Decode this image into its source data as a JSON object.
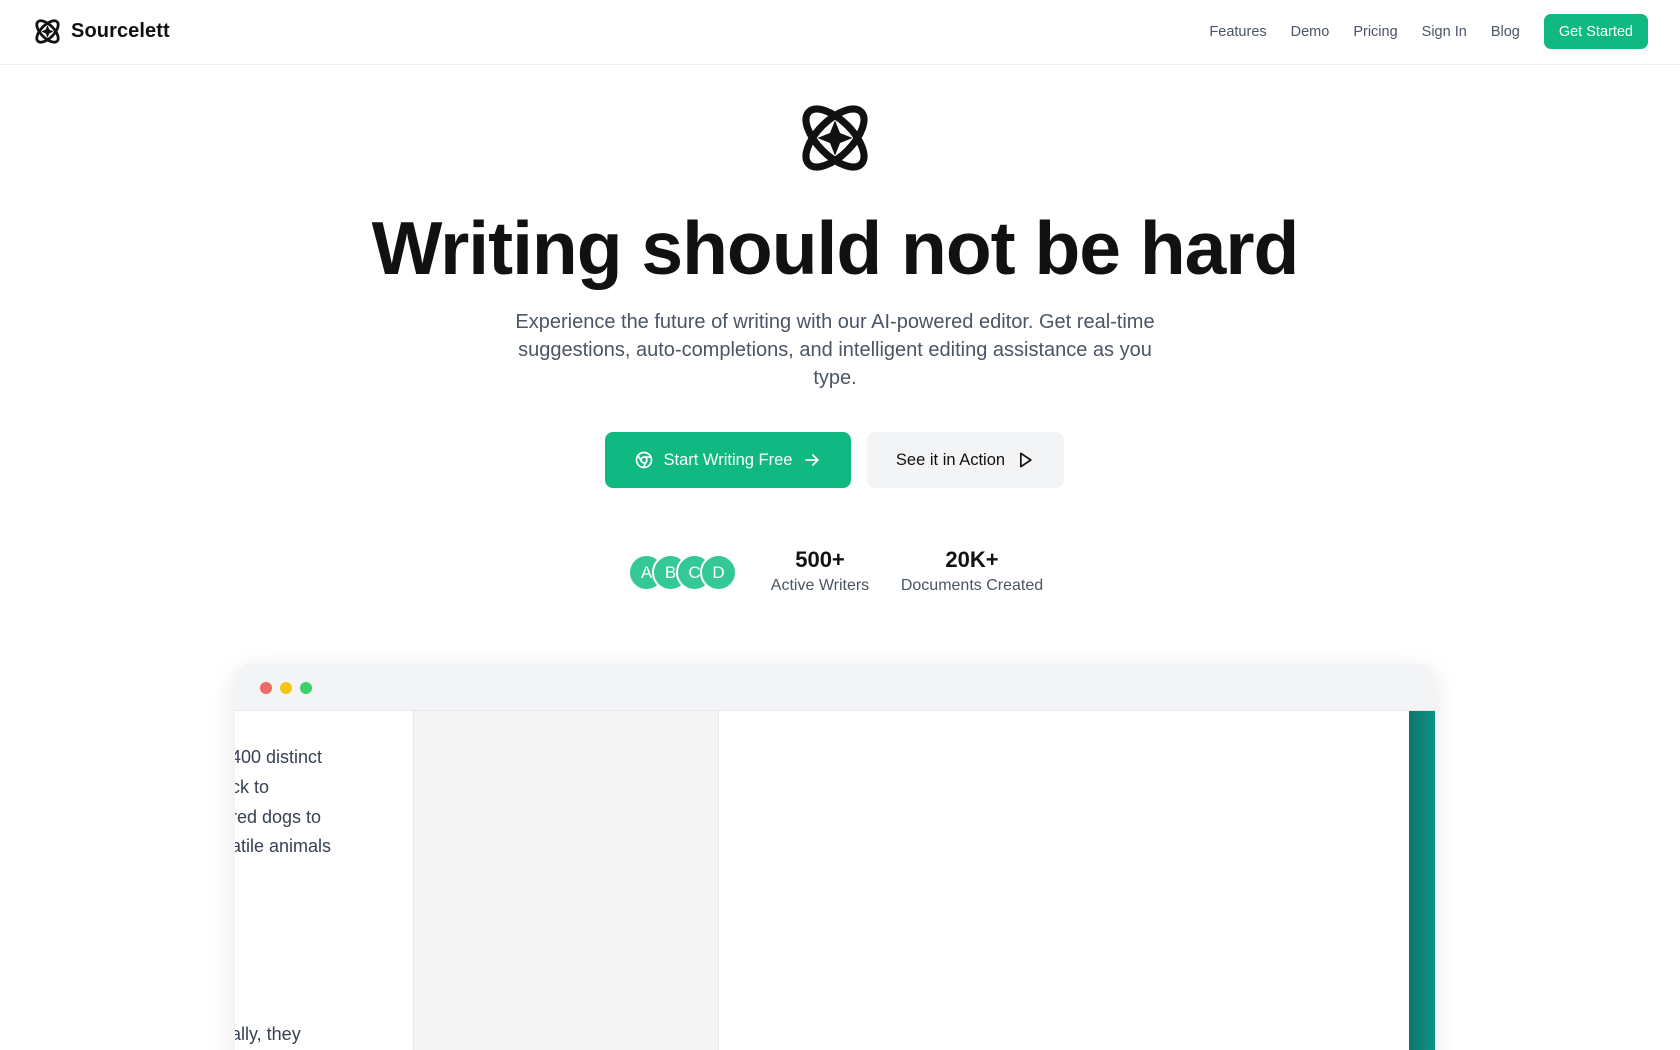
{
  "brand": {
    "name": "Sourcelett",
    "logo_icon": "orbit-sparkle-logo-icon"
  },
  "nav": {
    "links": [
      "Features",
      "Demo",
      "Pricing",
      "Sign In",
      "Blog"
    ],
    "cta": "Get Started"
  },
  "hero": {
    "title": "Writing should not be hard",
    "subtitle": "Experience the future of writing with our AI-powered editor. Get real-time suggestions, auto-completions, and intelligent editing assistance as you type.",
    "primary_button": {
      "label": "Start Writing Free",
      "icon": "chrome-icon",
      "trailing_icon": "arrow-right-icon"
    },
    "secondary_button": {
      "label": "See it in Action",
      "icon": "play-icon"
    }
  },
  "stats": {
    "avatars": [
      "A",
      "B",
      "C",
      "D"
    ],
    "items": [
      {
        "value": "500+",
        "label": "Active Writers"
      },
      {
        "value": "20K+",
        "label": "Documents Created"
      }
    ]
  },
  "preview": {
    "window_dots": [
      "#ef6b6b",
      "#f5c518",
      "#3ccf6e"
    ],
    "text_lines": [
      "400 distinct",
      "ck to",
      "red dogs to",
      "atile animals",
      "ally, they"
    ]
  },
  "colors": {
    "accent": "#10b981",
    "avatar": "#34c994",
    "dark_teal": "#0f766e"
  }
}
